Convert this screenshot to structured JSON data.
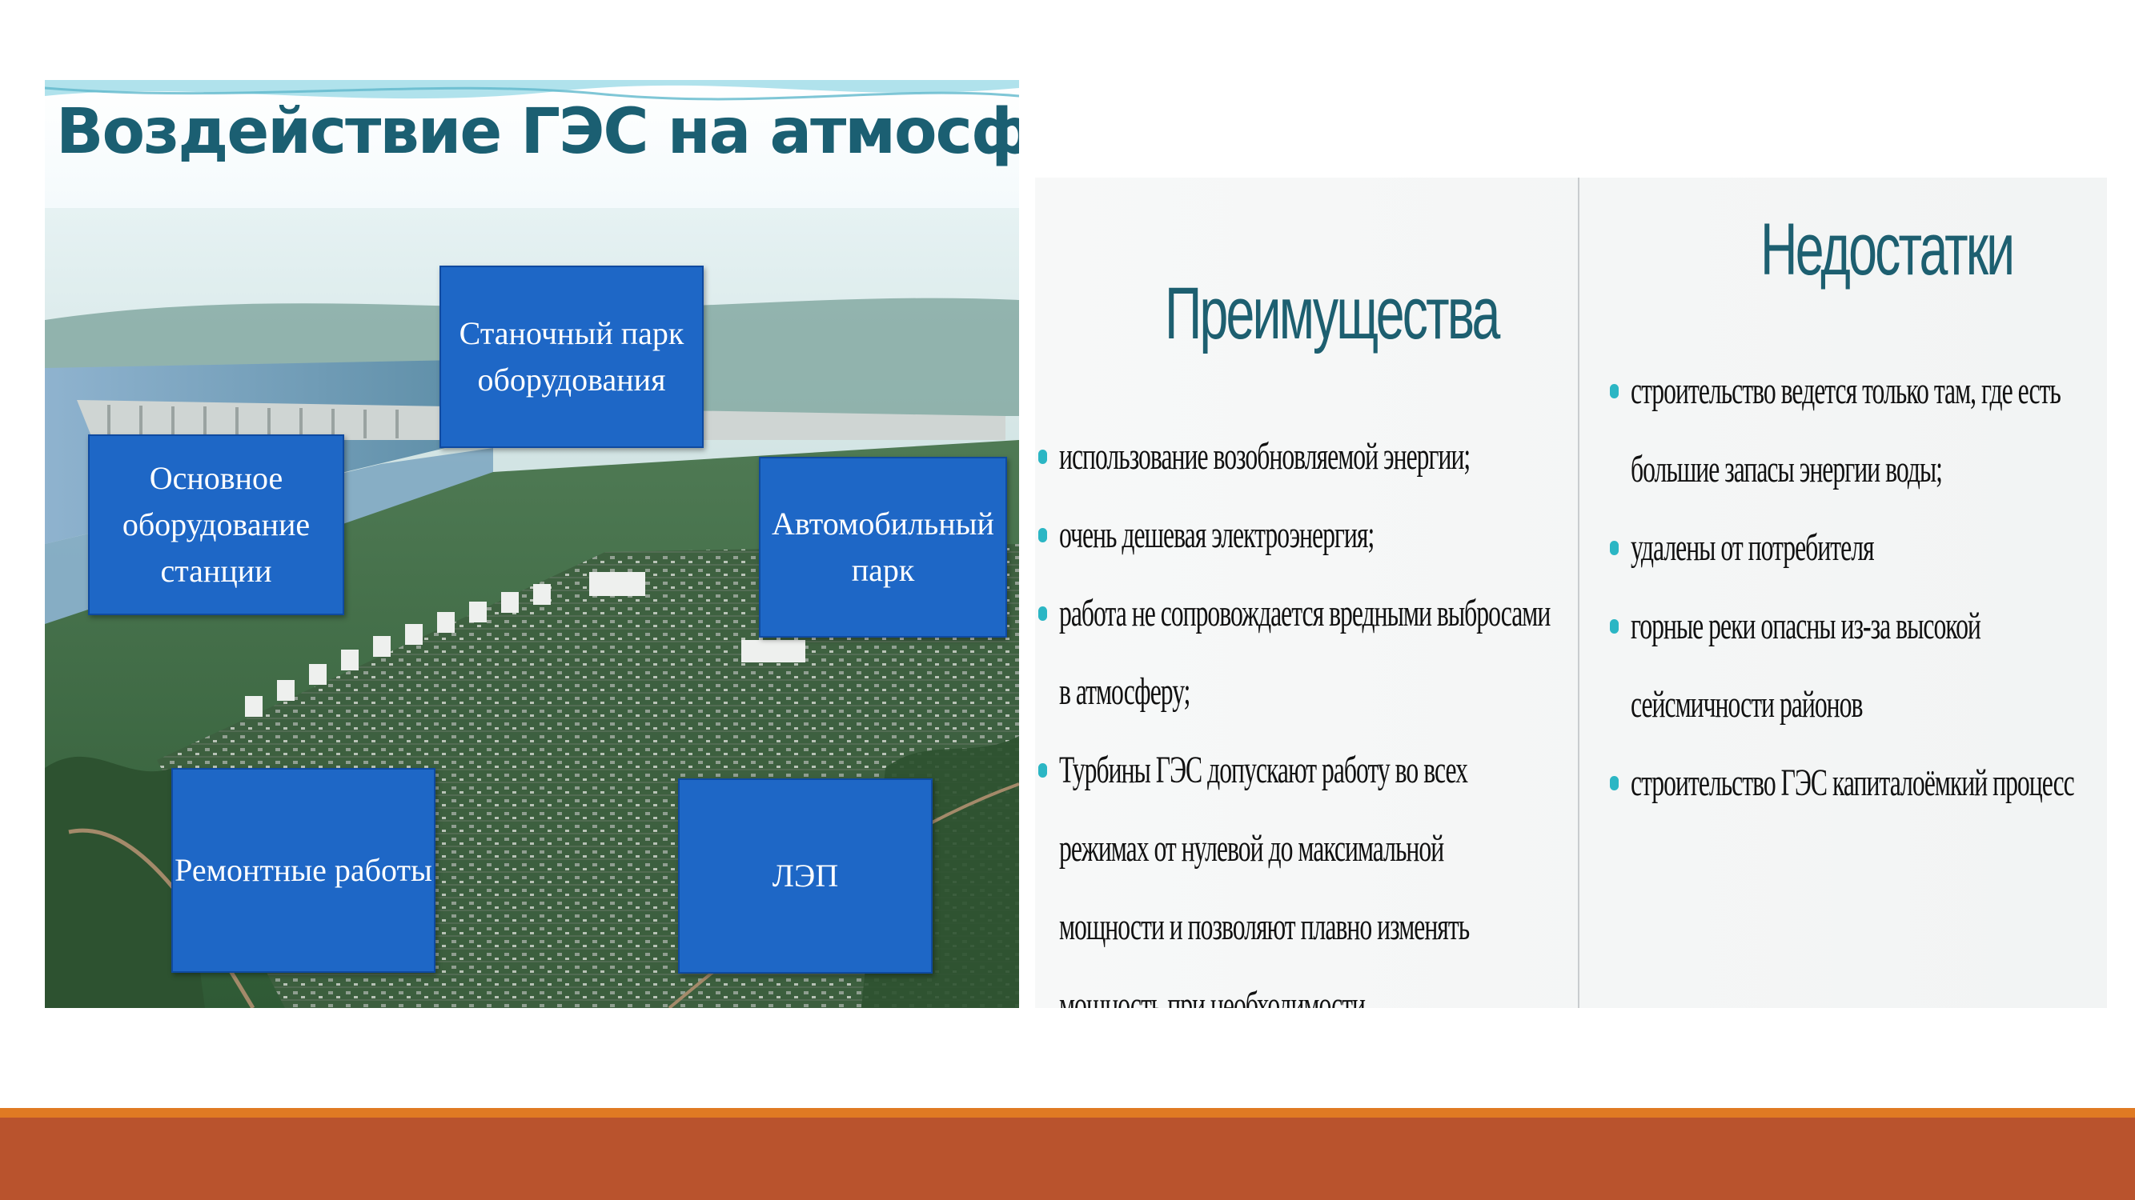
{
  "left_slide": {
    "title": "Воздействие ГЭС на атмосферу",
    "boxes": [
      {
        "id": "machine-park",
        "label": "Станочный парк\nоборудования"
      },
      {
        "id": "main-equipment",
        "label": "Основное\nоборудование\nстанции"
      },
      {
        "id": "auto-park",
        "label": "Автомобильный\nпарк"
      },
      {
        "id": "repair",
        "label": "Ремонтные работы"
      },
      {
        "id": "power-lines",
        "label": "ЛЭП"
      }
    ],
    "photo": "hydroelectric-dam-aerial-photo"
  },
  "right_slide": {
    "advantages": {
      "heading": "Преимущества",
      "items": [
        "использование возобновляемой энергии;",
        "очень дешевая электроэнергия;",
        "работа не сопровождается вредными выбросами в атмосферу;",
        "Турбины ГЭС допускают работу во всех режимах от нулевой до максимальной мощности и позволяют плавно изменять мощность при необходимости"
      ]
    },
    "disadvantages": {
      "heading": "Недостатки",
      "items": [
        "строительство ведется только там, где есть большие запасы энергии воды;",
        "удалены от потребителя",
        "горные реки опасны из-за высокой сейсмичности районов",
        "строительство ГЭС капиталоёмкий процесс"
      ]
    }
  },
  "colors": {
    "title_teal": "#1b5f72",
    "box_blue": "#1e67c6",
    "bullet_teal": "#2bb6c4",
    "footer_orange": "#e07a23",
    "footer_rust": "#b9532d"
  }
}
